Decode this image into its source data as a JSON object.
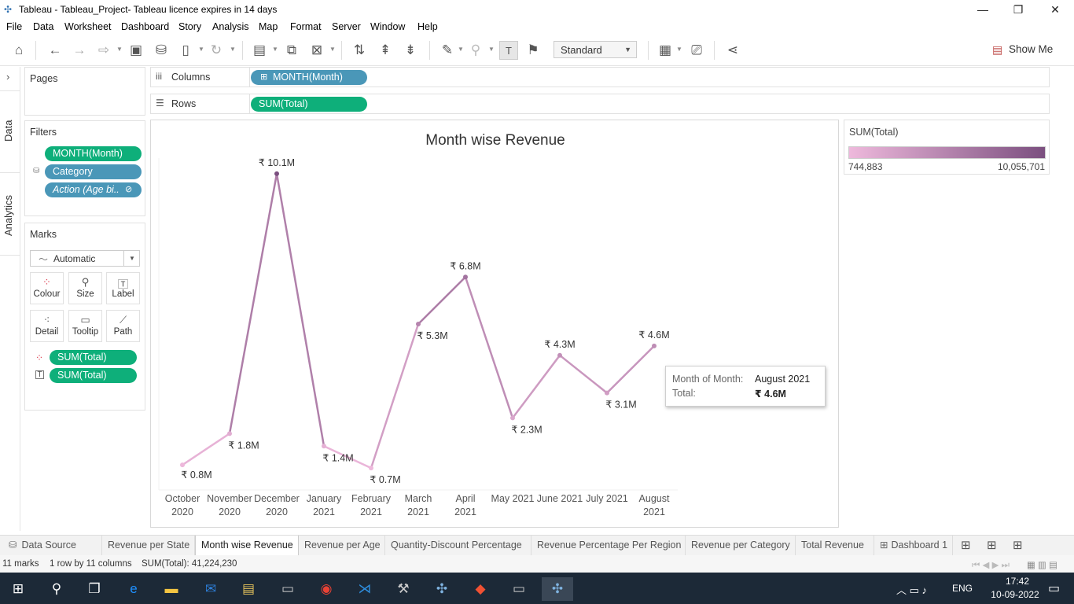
{
  "window": {
    "title": "Tableau - Tableau_Project- Tableau licence expires in 14 days",
    "controls": [
      "minimize",
      "restore",
      "close"
    ]
  },
  "menu": [
    "File",
    "Data",
    "Worksheet",
    "Dashboard",
    "Story",
    "Analysis",
    "Map",
    "Format",
    "Server",
    "Window",
    "Help"
  ],
  "toolbar": {
    "fit_select": "Standard",
    "show_me": "Show Me"
  },
  "side_tabs": {
    "data": "Data",
    "analytics": "Analytics"
  },
  "pages": {
    "title": "Pages"
  },
  "filters": {
    "title": "Filters",
    "items": [
      "MONTH(Month)",
      "Category",
      "Action (Age bi.."
    ]
  },
  "marks": {
    "title": "Marks",
    "type": "Automatic",
    "cards": [
      "Colour",
      "Size",
      "Label",
      "Detail",
      "Tooltip",
      "Path"
    ],
    "fields": [
      "SUM(Total)",
      "SUM(Total)"
    ]
  },
  "shelves": {
    "columns_label": "Columns",
    "columns_pill": "MONTH(Month)",
    "rows_label": "Rows",
    "rows_pill": "SUM(Total)"
  },
  "legend": {
    "title": "SUM(Total)",
    "min": "744,883",
    "max": "10,055,701",
    "color_low": "#eeb9dc",
    "color_high": "#7b4f7f"
  },
  "tooltip": {
    "key1": "Month of Month:",
    "val1": "August 2021",
    "key2": "Total:",
    "val2": "₹ 4.6M"
  },
  "chart_data": {
    "type": "line",
    "title": "Month wise Revenue",
    "categories": [
      [
        "October",
        "2020"
      ],
      [
        "November",
        "2020"
      ],
      [
        "December",
        "2020"
      ],
      [
        "January",
        "2021"
      ],
      [
        "February",
        "2021"
      ],
      [
        "March",
        "2021"
      ],
      [
        "April",
        "2021"
      ],
      [
        "May 2021",
        ""
      ],
      [
        "June 2021",
        ""
      ],
      [
        "July 2021",
        ""
      ],
      [
        "August",
        "2021"
      ]
    ],
    "values": [
      0.8,
      1.8,
      10.1,
      1.4,
      0.7,
      5.3,
      6.8,
      2.3,
      4.3,
      3.1,
      4.6
    ],
    "data_labels": [
      "₹ 0.8M",
      "₹ 1.8M",
      "₹ 10.1M",
      "₹ 1.4M",
      "₹ 0.7M",
      "₹ 5.3M",
      "₹ 6.8M",
      "₹ 2.3M",
      "₹ 4.3M",
      "₹ 3.1M",
      "₹ 4.6M"
    ],
    "ylim": [
      0,
      10.6
    ],
    "grid": false
  },
  "sheet_tabs": [
    "Data Source",
    "Revenue per State",
    "Month wise Revenue",
    "Revenue per Age",
    "Quantity-Discount Percentage",
    "Revenue Percentage Per Region",
    "Revenue per Category",
    "Total Revenue",
    "Dashboard 1"
  ],
  "active_tab": "Month wise Revenue",
  "status": {
    "marks": "11 marks",
    "shape": "1 row by 11 columns",
    "sum": "SUM(Total): 41,224,230"
  },
  "taskbar": {
    "lang": "ENG",
    "time": "17:42",
    "date": "10-09-2022"
  }
}
